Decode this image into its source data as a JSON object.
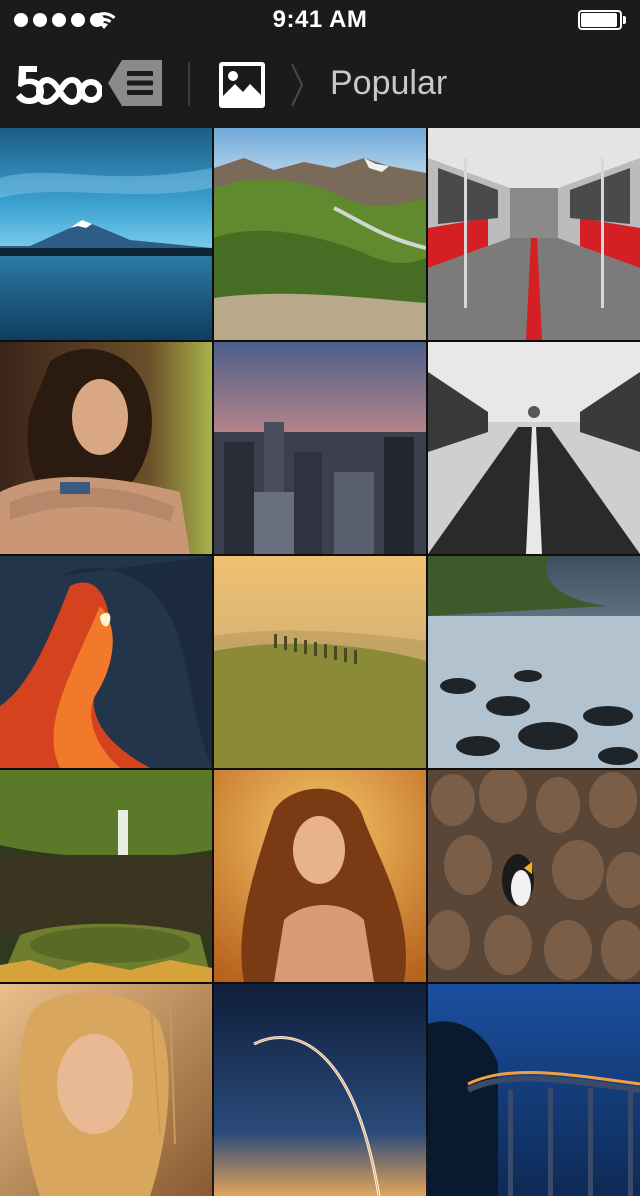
{
  "status_bar": {
    "time": "9:41 AM",
    "signal_bars": 5,
    "battery_level": 1.0
  },
  "nav": {
    "logo_icon": "500px-logo-icon",
    "menu_icon": "menu-list-icon",
    "photo_icon": "photo-icon",
    "separator_icon": "chevron-right-icon",
    "title": "Popular"
  },
  "colors": {
    "background": "#1b1b1b",
    "title_text": "#c8c8c8",
    "icon_gray": "#8a8a8a"
  },
  "photos": [
    {
      "subject": "mountain-lake"
    },
    {
      "subject": "green-valley-mountains"
    },
    {
      "subject": "subway-car-interior"
    },
    {
      "subject": "portrait-woman-brunette"
    },
    {
      "subject": "city-skyline-dusk"
    },
    {
      "subject": "snowy-road-trees"
    },
    {
      "subject": "canyon-red-rock"
    },
    {
      "subject": "tuscan-hills-cypress"
    },
    {
      "subject": "rocky-coast-long-exposure"
    },
    {
      "subject": "waterfall-pond-forest"
    },
    {
      "subject": "portrait-woman-golden-light"
    },
    {
      "subject": "penguin-colony"
    },
    {
      "subject": "portrait-woman-blonde"
    },
    {
      "subject": "rocket-launch-trail"
    },
    {
      "subject": "coastal-bridge-night"
    }
  ]
}
